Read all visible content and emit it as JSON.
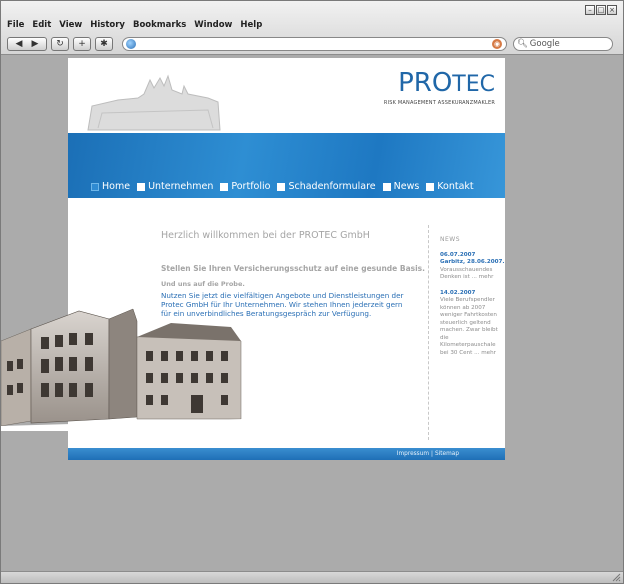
{
  "browser": {
    "menu": [
      "File",
      "Edit",
      "View",
      "History",
      "Bookmarks",
      "Window",
      "Help"
    ],
    "search_placeholder": "Google",
    "window_controls": [
      "minimize",
      "maximize",
      "close"
    ]
  },
  "site": {
    "logo_pro": "PRO",
    "logo_tec": "TEC",
    "logo_sub": "RISK MANAGEMENT ASSEKURANZMAKLER",
    "nav": [
      "Home",
      "Unternehmen",
      "Portfolio",
      "Schadenformulare",
      "News",
      "Kontakt"
    ],
    "active_nav": "Home",
    "welcome": "Herzlich willkommen bei der PROTEC GmbH",
    "sub1": "Stellen Sie Ihren Versicherungsschutz auf eine gesunde Basis.",
    "sub2": "Und uns auf die Probe.",
    "intro": "Nutzen Sie jetzt die vielfältigen Angebote und Dienstleistungen der Protec GmbH für Ihr Unternehmen. Wir stehen Ihnen jederzeit gern für ein unverbindliches Beratungsgespräch zur Verfügung.",
    "news_title": "NEWS",
    "news": [
      {
        "date": "06.07.2007",
        "headline": "Garbitz, 28.06.2007.",
        "text": "Vorausschauendes Denken ist ... mehr"
      },
      {
        "date": "14.02.2007",
        "headline": "",
        "text": "Viele Berufspendler können ab 2007 weniger Fahrtkosten steuerlich geltend machen. Zwar bleibt die Kilometerpauschale bei 30 Cent ... mehr"
      }
    ],
    "footer_impressum": "Impressum",
    "footer_sitemap": "Sitemap",
    "accent_color": "#2067a8"
  }
}
